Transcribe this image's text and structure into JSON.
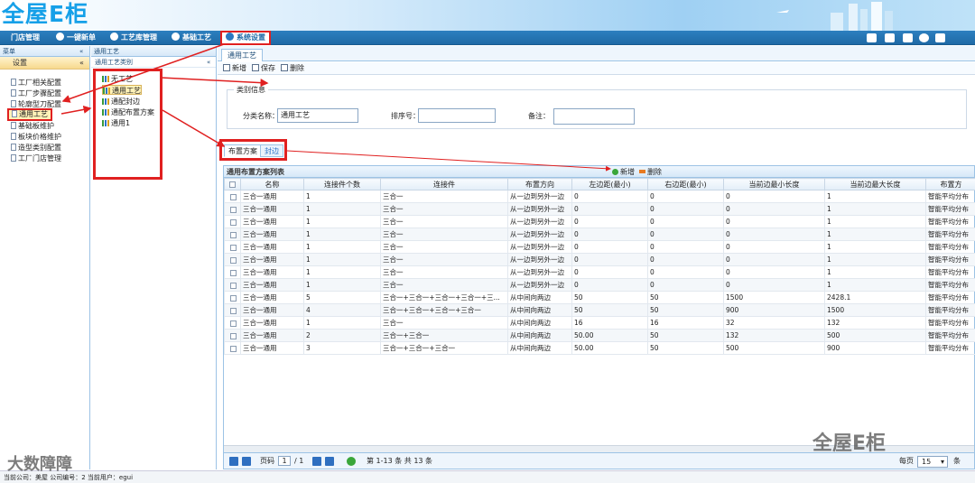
{
  "app": {
    "logo_text": "全屋E柜"
  },
  "nav": {
    "items": [
      "门店管理",
      "一键新单",
      "工艺库管理",
      "基础工艺",
      "系统设置"
    ]
  },
  "left": {
    "header": "菜单",
    "section": "设置",
    "items": [
      "工厂相关配置",
      "工厂步骤配置",
      "轮廓型刀配置",
      "通用工艺",
      "基础板维护",
      "板块价格维护",
      "造型类别配置",
      "工厂门店管理"
    ]
  },
  "mid": {
    "header": "通用工艺",
    "subheader": "通用工艺类别",
    "items": [
      "无工艺",
      "通用工艺",
      "通配封边",
      "通配布置方案",
      "通用1"
    ]
  },
  "main": {
    "tab": "通用工艺",
    "toolbar": {
      "add": "新增",
      "save": "保存",
      "del": "删除"
    },
    "fieldset_label": "类别信息",
    "form": {
      "name_label": "分类名称：",
      "name_value": "通用工艺",
      "order_label": "排序号：",
      "note_label": "备注："
    },
    "subtabs": [
      "布置方案",
      "封边"
    ],
    "grid": {
      "title": "通用布置方案列表",
      "add": "新增",
      "del": "删除",
      "columns": [
        "名称",
        "连接件个数",
        "连接件",
        "布置方向",
        "左边距(最小)",
        "右边距(最小)",
        "当前边最小长度",
        "当前边最大长度",
        "布置方"
      ],
      "rows": [
        [
          "三合一通用",
          "1",
          "三合一",
          "从一边到另外一边",
          "0",
          "0",
          "0",
          "1",
          "智能平均分布"
        ],
        [
          "三合一通用",
          "1",
          "三合一",
          "从一边到另外一边",
          "0",
          "0",
          "0",
          "1",
          "智能平均分布"
        ],
        [
          "三合一通用",
          "1",
          "三合一",
          "从一边到另外一边",
          "0",
          "0",
          "0",
          "1",
          "智能平均分布"
        ],
        [
          "三合一通用",
          "1",
          "三合一",
          "从一边到另外一边",
          "0",
          "0",
          "0",
          "1",
          "智能平均分布"
        ],
        [
          "三合一通用",
          "1",
          "三合一",
          "从一边到另外一边",
          "0",
          "0",
          "0",
          "1",
          "智能平均分布"
        ],
        [
          "三合一通用",
          "1",
          "三合一",
          "从一边到另外一边",
          "0",
          "0",
          "0",
          "1",
          "智能平均分布"
        ],
        [
          "三合一通用",
          "1",
          "三合一",
          "从一边到另外一边",
          "0",
          "0",
          "0",
          "1",
          "智能平均分布"
        ],
        [
          "三合一通用",
          "1",
          "三合一",
          "从一边到另外一边",
          "0",
          "0",
          "0",
          "1",
          "智能平均分布"
        ],
        [
          "三合一通用",
          "5",
          "三合一+三合一+三合一+三合一+三...",
          "从中间向两边",
          "50",
          "50",
          "1500",
          "2428.1",
          "智能平均分布"
        ],
        [
          "三合一通用",
          "4",
          "三合一+三合一+三合一+三合一",
          "从中间向两边",
          "50",
          "50",
          "900",
          "1500",
          "智能平均分布"
        ],
        [
          "三合一通用",
          "1",
          "三合一",
          "从中间向两边",
          "16",
          "16",
          "32",
          "132",
          "智能平均分布"
        ],
        [
          "三合一通用",
          "2",
          "三合一+三合一",
          "从中间向两边",
          "50.00",
          "50",
          "132",
          "500",
          "智能平均分布"
        ],
        [
          "三合一通用",
          "3",
          "三合一+三合一+三合一",
          "从中间向两边",
          "50.00",
          "50",
          "500",
          "900",
          "智能平均分布"
        ]
      ]
    },
    "pager": {
      "page_label": "页码",
      "page_value": "1",
      "page_total": "/ 1",
      "summary": "第 1-13 条  共 13 条",
      "per_page_label": "每页",
      "per_page_value": "15",
      "unit": "条"
    }
  },
  "status": {
    "text": "当前公司：美屋   公司编号：2   当前用户：egui"
  },
  "watermarks": {
    "left": "大数障障",
    "right": "全屋E柜"
  }
}
